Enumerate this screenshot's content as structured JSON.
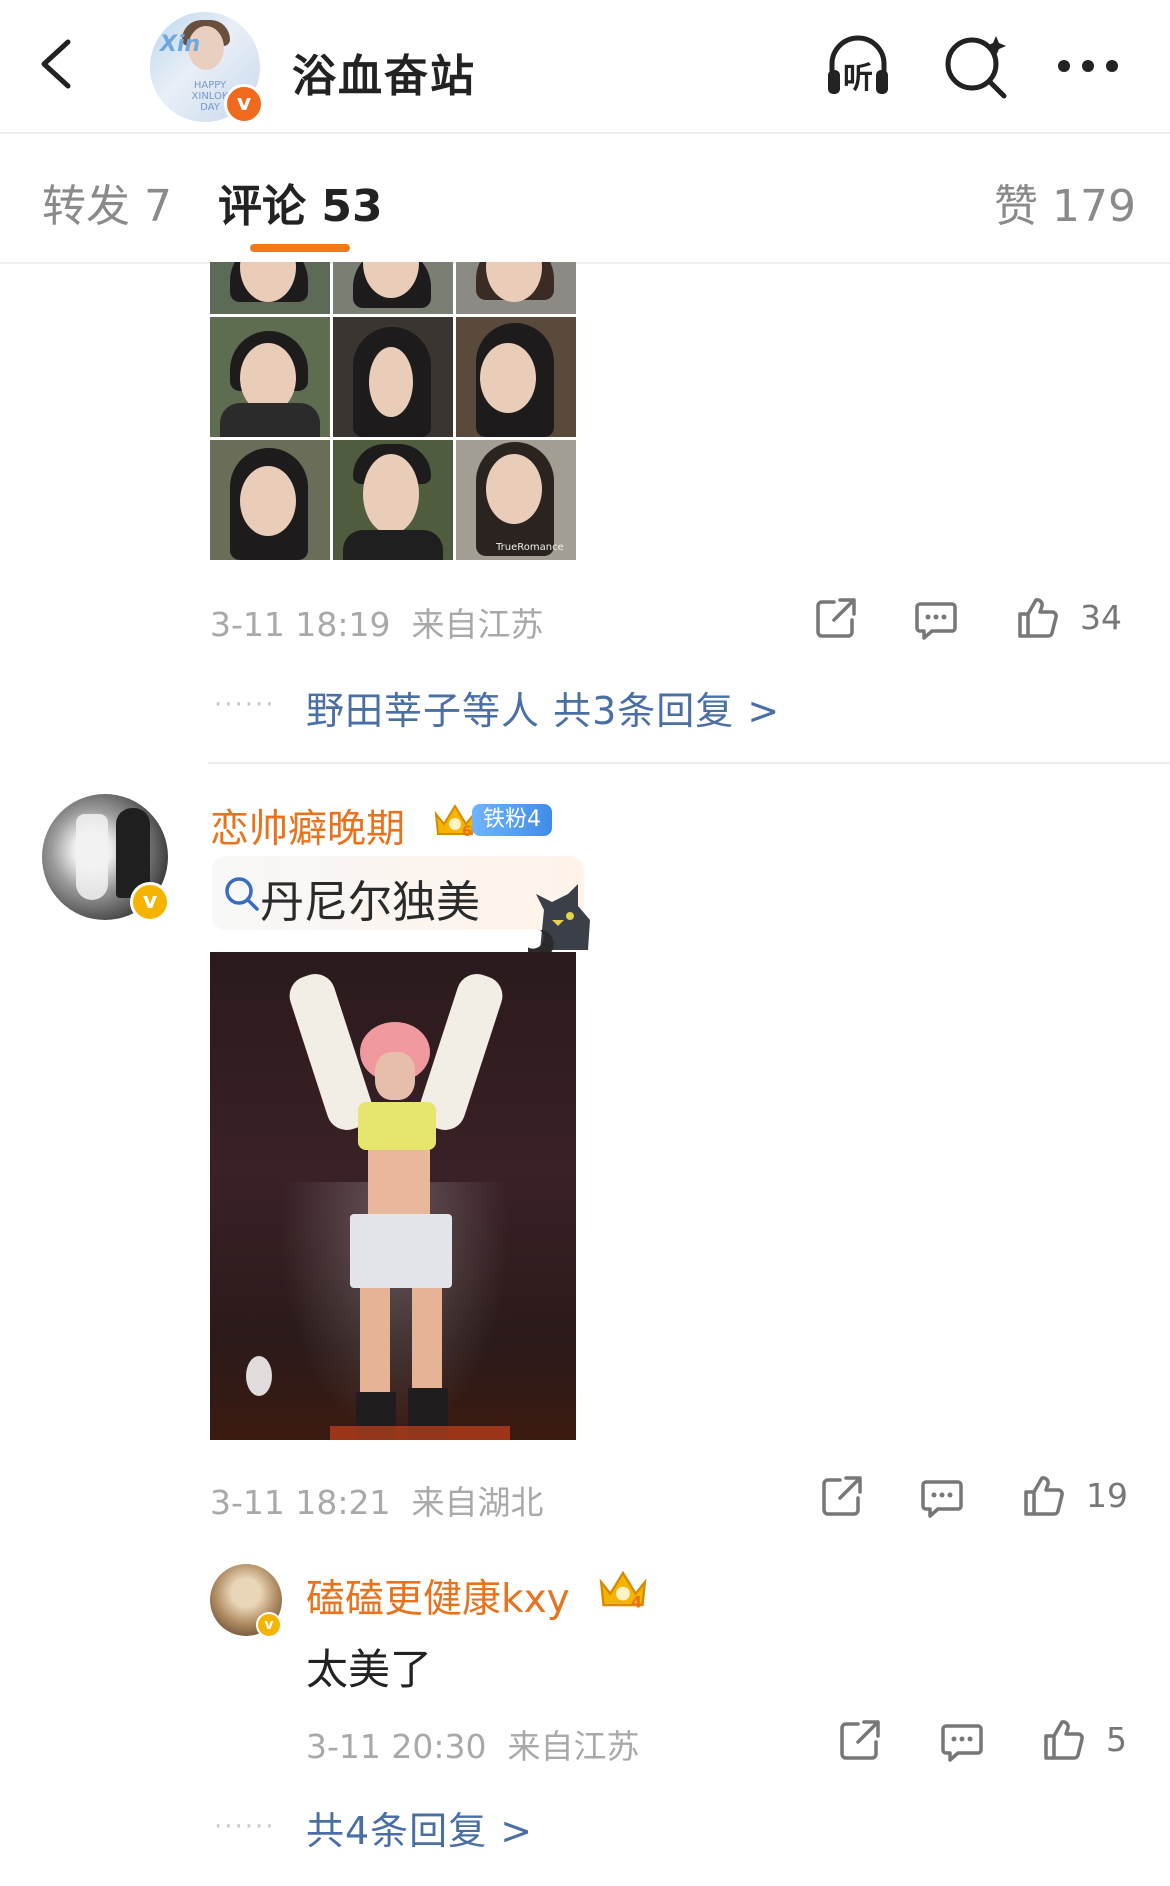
{
  "header": {
    "title": "浴血奋站",
    "listen_label": "听"
  },
  "tabs": [
    {
      "label": "转发",
      "count": "7"
    },
    {
      "label": "评论",
      "count": "53"
    },
    {
      "label": "赞",
      "count": "179"
    }
  ],
  "comment1": {
    "image_watermark": "TrueRomance",
    "time": "3-11 18:19",
    "location": "来自江苏",
    "like_count": "34",
    "replies_dots": "······",
    "replies_link": "野田莘子等人 共3条回复 >"
  },
  "comment2": {
    "username": "恋帅癖晚期",
    "fan_badge": "铁粉4",
    "crown_level": "6",
    "search_text": "丹尼尔独美",
    "time": "3-11 18:21",
    "location": "来自湖北",
    "like_count": "19"
  },
  "reply": {
    "username": "磕磕更健康kxy",
    "crown_level": "4",
    "text": "太美了",
    "time": "3-11 20:30",
    "location": "来自江苏",
    "like_count": "5",
    "replies_dots": "······",
    "replies_link": "共4条回复 >"
  },
  "colors": {
    "username": "#e8731e",
    "link": "#4a6fa5",
    "tab_underline": "#f27a14",
    "verified_orange": "#f06a1d",
    "verified_gold": "#f5b400",
    "meta_gray": "#a9a9a9"
  },
  "icons": [
    "back-icon",
    "listen-icon",
    "search-icon",
    "more-icon",
    "share-icon",
    "comment-icon",
    "like-icon",
    "search-chip-icon",
    "crown-icon",
    "verified-icon"
  ]
}
